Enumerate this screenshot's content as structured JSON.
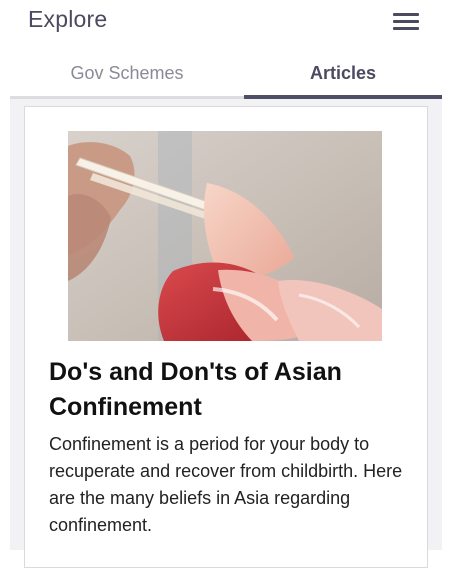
{
  "header": {
    "title": "Explore",
    "menu_icon": "hamburger-menu-icon"
  },
  "tabs": [
    {
      "label": "Gov Schemes",
      "active": false
    },
    {
      "label": "Articles",
      "active": true
    }
  ],
  "article": {
    "title": "Do's and Don'ts of Asian Confinement",
    "summary": "Confinement is a period for your body to recuperate and recover from childbirth. Here are the many beliefs in Asia regarding confinement."
  },
  "colors": {
    "primary_text": "#4c4a5f",
    "inactive_tab": "#8b8a97",
    "active_indicator": "#4f4e68",
    "page_background": "#f2f2f4"
  }
}
